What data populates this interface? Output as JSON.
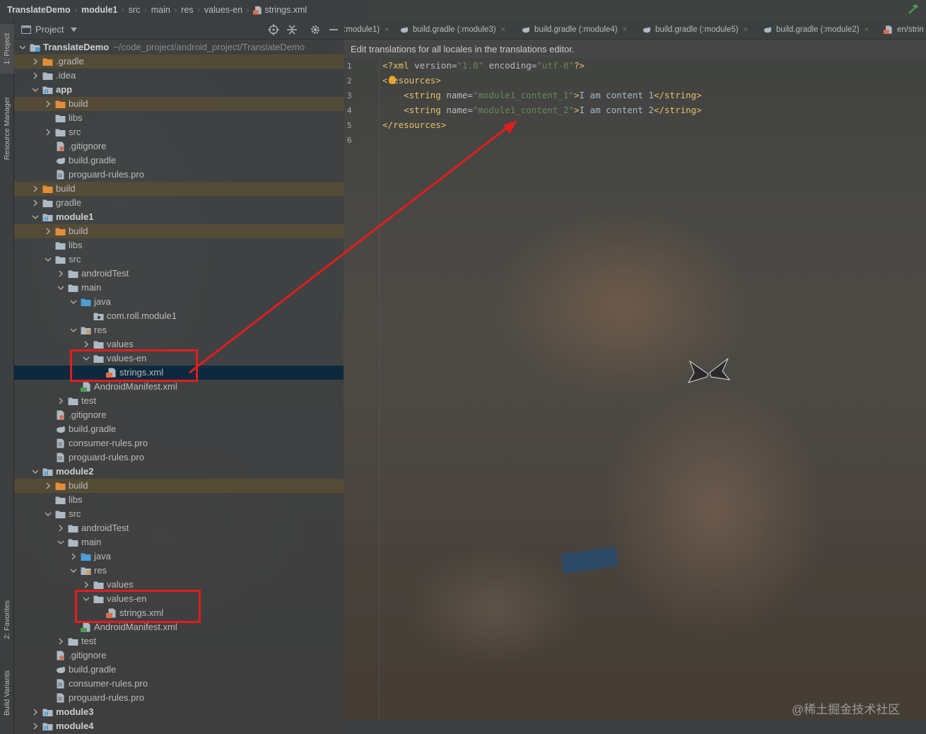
{
  "breadcrumb": [
    "TranslateDemo",
    "module1",
    "src",
    "main",
    "res",
    "values-en",
    "strings.xml"
  ],
  "project_panel": {
    "title": "Project"
  },
  "tool_strip": {
    "project": "1: Project",
    "resource_manager": "Resource Manager",
    "favorites": "2: Favorites",
    "build_variants": "Build Variants"
  },
  "tree": [
    {
      "label": "TranslateDemo",
      "hint": "~/code_project/android_project/TranslateDemo",
      "bold": true,
      "icon": "module-icon",
      "expanded": true
    },
    {
      "label": ".gradle",
      "icon": "folder-orange-icon",
      "excluded": true,
      "expanded": false
    },
    {
      "label": ".idea",
      "icon": "folder-icon",
      "expanded": false
    },
    {
      "label": "app",
      "icon": "module-folder-icon",
      "bold": true,
      "expanded": true
    },
    {
      "label": "build",
      "icon": "folder-orange-icon",
      "excluded": true,
      "expanded": false
    },
    {
      "label": "libs",
      "icon": "folder-icon"
    },
    {
      "label": "src",
      "icon": "folder-icon",
      "expanded": false
    },
    {
      "label": ".gitignore",
      "icon": "gitignore-icon"
    },
    {
      "label": "build.gradle",
      "icon": "gradle-icon"
    },
    {
      "label": "proguard-rules.pro",
      "icon": "file-icon"
    },
    {
      "label": "build",
      "icon": "folder-orange-icon",
      "excluded": true,
      "expanded": false
    },
    {
      "label": "gradle",
      "icon": "folder-icon",
      "expanded": false
    },
    {
      "label": "module1",
      "icon": "module-folder-icon",
      "bold": true,
      "expanded": true
    },
    {
      "label": "build",
      "icon": "folder-orange-icon",
      "excluded": true,
      "expanded": false
    },
    {
      "label": "libs",
      "icon": "folder-icon"
    },
    {
      "label": "src",
      "icon": "folder-icon",
      "expanded": true
    },
    {
      "label": "androidTest",
      "icon": "folder-icon",
      "expanded": false
    },
    {
      "label": "main",
      "icon": "folder-icon",
      "expanded": true
    },
    {
      "label": "java",
      "icon": "folder-blue-icon",
      "expanded": true
    },
    {
      "label": "com.roll.module1",
      "icon": "package-icon"
    },
    {
      "label": "res",
      "icon": "res-folder-icon",
      "expanded": true
    },
    {
      "label": "values",
      "icon": "folder-icon",
      "expanded": false
    },
    {
      "label": "values-en",
      "icon": "folder-icon",
      "expanded": true
    },
    {
      "label": "strings.xml",
      "icon": "xml-file-icon",
      "selected": true
    },
    {
      "label": "AndroidManifest.xml",
      "icon": "manifest-icon"
    },
    {
      "label": "test",
      "icon": "folder-icon",
      "expanded": false
    },
    {
      "label": ".gitignore",
      "icon": "gitignore-icon"
    },
    {
      "label": "build.gradle",
      "icon": "gradle-icon"
    },
    {
      "label": "consumer-rules.pro",
      "icon": "file-icon"
    },
    {
      "label": "proguard-rules.pro",
      "icon": "file-icon"
    },
    {
      "label": "module2",
      "icon": "module-folder-icon",
      "bold": true,
      "expanded": true
    },
    {
      "label": "build",
      "icon": "folder-orange-icon",
      "excluded": true,
      "expanded": false
    },
    {
      "label": "libs",
      "icon": "folder-icon"
    },
    {
      "label": "src",
      "icon": "folder-icon",
      "expanded": true
    },
    {
      "label": "androidTest",
      "icon": "folder-icon",
      "expanded": false
    },
    {
      "label": "main",
      "icon": "folder-icon",
      "expanded": true
    },
    {
      "label": "java",
      "icon": "folder-blue-icon",
      "expanded": false
    },
    {
      "label": "res",
      "icon": "res-folder-icon",
      "expanded": true
    },
    {
      "label": "values",
      "icon": "folder-icon",
      "expanded": false
    },
    {
      "label": "values-en",
      "icon": "folder-icon",
      "expanded": true
    },
    {
      "label": "strings.xml",
      "icon": "xml-file-icon"
    },
    {
      "label": "AndroidManifest.xml",
      "icon": "manifest-icon"
    },
    {
      "label": "test",
      "icon": "folder-icon",
      "expanded": false
    },
    {
      "label": ".gitignore",
      "icon": "gitignore-icon"
    },
    {
      "label": "build.gradle",
      "icon": "gradle-icon"
    },
    {
      "label": "consumer-rules.pro",
      "icon": "file-icon"
    },
    {
      "label": "proguard-rules.pro",
      "icon": "file-icon"
    },
    {
      "label": "module3",
      "icon": "module-folder-icon",
      "bold": true,
      "expanded": false
    },
    {
      "label": "module4",
      "icon": "module-folder-icon",
      "bold": true,
      "expanded": false
    }
  ],
  "tabs": [
    {
      "label": ":module1)",
      "icon": null
    },
    {
      "label": "build.gradle (:module3)",
      "icon": "gradle-icon"
    },
    {
      "label": "build.gradle (:module4)",
      "icon": "gradle-icon"
    },
    {
      "label": "build.gradle (:module5)",
      "icon": "gradle-icon"
    },
    {
      "label": "build.gradle (:module2)",
      "icon": "gradle-icon"
    },
    {
      "label": "en/strin",
      "icon": "xml-file-icon"
    }
  ],
  "banner": "Edit translations for all locales in the translations editor.",
  "editor": {
    "line_numbers": [
      "1",
      "2",
      "3",
      "4",
      "5",
      "6"
    ],
    "lines": [
      {
        "tokens": [
          {
            "t": "tag",
            "v": "<?xml "
          },
          {
            "t": "attr",
            "v": "version="
          },
          {
            "t": "val",
            "v": "\"1.0\""
          },
          {
            "t": "txt",
            "v": " "
          },
          {
            "t": "attr",
            "v": "encoding="
          },
          {
            "t": "val",
            "v": "\"utf-8\""
          },
          {
            "t": "tag",
            "v": "?>"
          }
        ]
      },
      {
        "tokens": [
          {
            "t": "tag",
            "v": "<resources>"
          }
        ]
      },
      {
        "tokens": [
          {
            "t": "txt",
            "v": "    "
          },
          {
            "t": "tag",
            "v": "<string "
          },
          {
            "t": "attr",
            "v": "name="
          },
          {
            "t": "val",
            "v": "\"module1_content_1\""
          },
          {
            "t": "tag",
            "v": ">"
          },
          {
            "t": "txt",
            "v": "I am content 1"
          },
          {
            "t": "tag",
            "v": "</string>"
          }
        ]
      },
      {
        "tokens": [
          {
            "t": "txt",
            "v": "    "
          },
          {
            "t": "tag",
            "v": "<string "
          },
          {
            "t": "attr",
            "v": "name="
          },
          {
            "t": "val",
            "v": "\"module1_content_2\""
          },
          {
            "t": "tag",
            "v": ">"
          },
          {
            "t": "txt",
            "v": "I am content 2"
          },
          {
            "t": "tag",
            "v": "</string>"
          }
        ]
      },
      {
        "tokens": [
          {
            "t": "tag",
            "v": "</resources>"
          }
        ]
      },
      {
        "tokens": []
      }
    ]
  },
  "watermark": "@稀土掘金技术社区",
  "colors": {
    "annotation_red": "#e21d1d",
    "selection": "#0d293e",
    "xml_tag": "#e8bf6a",
    "xml_value": "#6a8759"
  }
}
